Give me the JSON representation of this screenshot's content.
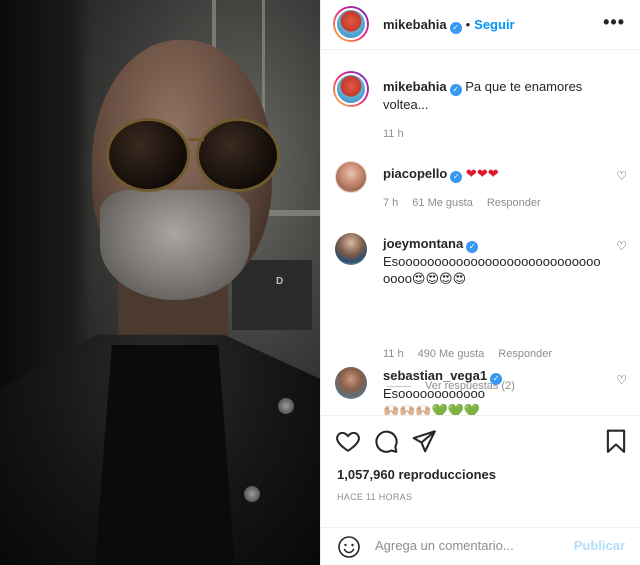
{
  "post": {
    "username": "mikebahia",
    "separator": "•",
    "follow_label": "Seguir",
    "more_label": "•••",
    "verified_mark": "✓"
  },
  "caption": {
    "username": "mikebahia",
    "text": "Pa que te enamores voltea...",
    "time": "11 h"
  },
  "comments": [
    {
      "username": "piacopello",
      "text": "❤❤❤",
      "time": "7 h",
      "likes": "61 Me gusta",
      "reply_label": "Responder"
    },
    {
      "username": "joeymontana",
      "text": "Esoooooooooooooooooooooooooooooooo",
      "emojis": "😍😍😍😍",
      "time": "11 h",
      "likes": "490 Me gusta",
      "reply_label": "Responder",
      "view_replies": "Ver respuestas (2)"
    },
    {
      "username": "sebastian_vega1",
      "text": "Esoooooooooooo",
      "emojis": "🙌🏼🙌🏼🙌🏼",
      "hearts": "💚💚💚"
    }
  ],
  "actions": {
    "like_icon": "heart-icon",
    "comment_icon": "comment-icon",
    "share_icon": "share-icon",
    "save_icon": "bookmark-icon",
    "views": "1,057,960 reproducciones",
    "posted": "HACE 11 HORAS"
  },
  "composer": {
    "placeholder": "Agrega un comentario...",
    "post_label": "Publicar",
    "emoji_icon": "smiley-icon"
  },
  "colors": {
    "link_blue": "#0095f6",
    "muted": "#8e8e8e",
    "verified": "#3897f0",
    "publish_disabled": "#b2dffc"
  }
}
